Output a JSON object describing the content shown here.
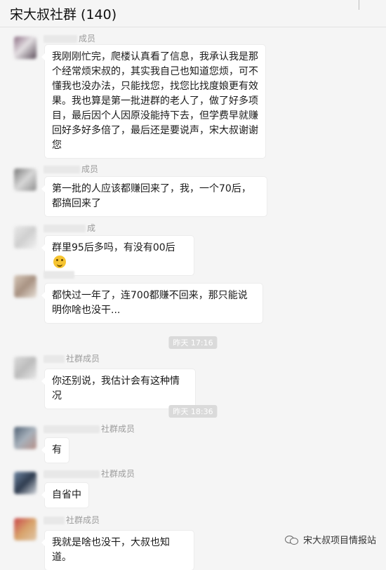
{
  "header": {
    "title": "宋大叔社群 (140)"
  },
  "messages": [
    {
      "sender": "成员",
      "text": "我刚刚忙完，爬楼认真看了信息，我承认我是那个经常烦宋叔的，其实我自己也知道您烦，可不懂我也没办法，只能找您，找您比找度娘更有效果。我也算是第一批进群的老人了，做了好多项目，最后因个人因原没能持下去，但学费早就赚回好多好多倍了，最后还是要说声，宋大叔谢谢您"
    },
    {
      "sender": "成员",
      "text": "第一批的人应该都赚回来了，我，一个70后，都搞回来了"
    },
    {
      "sender": "成",
      "text": "群里95后多吗，有没有00后"
    },
    {
      "sender": "",
      "text": "都快过一年了，连700都赚不回来，那只能说明你啥也没干..."
    },
    {
      "sender": "社群成员",
      "text": "你还别说，我估计会有这种情况"
    },
    {
      "sender": "社群成员",
      "text": "有"
    },
    {
      "sender": "社群成员",
      "text": "自省中"
    },
    {
      "sender": "社群成员",
      "text": "我就是啥也没干，大叔也知道。"
    }
  ],
  "timestamps": [
    "昨天 17:16",
    "昨天 18:36"
  ],
  "watermark": {
    "text": "宋大叔项目情报站",
    "icon": "wechat-icon"
  },
  "colors": {
    "avatar1": "#7d6a7a",
    "avatar2": "#8a8a8a",
    "avatar3": "#cfcfcf",
    "avatar4": "#b8a898",
    "avatar5": "#c9c9c9",
    "avatar6": "#5a6b7c",
    "avatar7": "#7b8fa6",
    "avatar8": "#c8474a"
  }
}
